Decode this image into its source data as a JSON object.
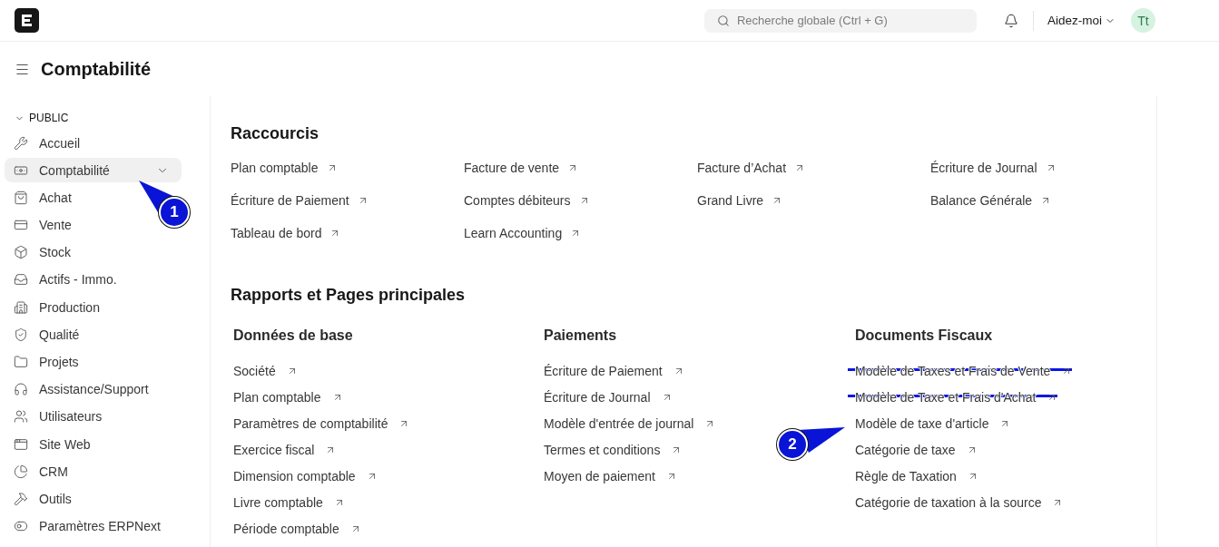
{
  "navbar": {
    "search": {
      "placeholder": "Recherche globale (Ctrl + G)"
    },
    "help": "Aidez-moi",
    "avatar": "Tt"
  },
  "page": {
    "title": "Comptabilité"
  },
  "sidebar": {
    "section": "PUBLIC",
    "expanded": true,
    "items": [
      {
        "label": "Accueil",
        "selected": false,
        "expanded": false
      },
      {
        "label": "Comptabilité",
        "selected": true,
        "expanded": true,
        "callout": "1"
      },
      {
        "label": "Achat",
        "selected": false,
        "expanded": false
      },
      {
        "label": "Vente",
        "selected": false,
        "expanded": false
      },
      {
        "label": "Stock",
        "selected": false,
        "expanded": false
      },
      {
        "label": "Actifs - Immo.",
        "selected": false,
        "expanded": false
      },
      {
        "label": "Production",
        "selected": false,
        "expanded": false
      },
      {
        "label": "Qualité",
        "selected": false,
        "expanded": false
      },
      {
        "label": "Projets",
        "selected": false,
        "expanded": false
      },
      {
        "label": "Assistance/Support",
        "selected": false,
        "expanded": false
      },
      {
        "label": "Utilisateurs",
        "selected": false,
        "expanded": false
      },
      {
        "label": "Site Web",
        "selected": false,
        "expanded": false
      },
      {
        "label": "CRM",
        "selected": false,
        "expanded": false
      },
      {
        "label": "Outils",
        "selected": false,
        "expanded": false
      },
      {
        "label": "Paramètres ERPNext",
        "selected": false,
        "expanded": false
      }
    ]
  },
  "shortcuts": {
    "title": "Raccourcis",
    "items": [
      "Plan comptable",
      "Facture de vente",
      "Facture d’Achat",
      "Écriture de Journal",
      "Écriture de Paiement",
      "Comptes débiteurs",
      "Grand Livre",
      "Balance Générale",
      "Tableau de bord",
      "Learn Accounting"
    ]
  },
  "reports": {
    "title": "Rapports et Pages principales",
    "columns": [
      {
        "title": "Données de base",
        "items": [
          {
            "label": "Société",
            "struck": false
          },
          {
            "label": "Plan comptable",
            "struck": false
          },
          {
            "label": "Paramètres de comptabilité",
            "struck": false
          },
          {
            "label": "Exercice fiscal",
            "struck": false
          },
          {
            "label": "Dimension comptable",
            "struck": false
          },
          {
            "label": "Livre comptable",
            "struck": false
          },
          {
            "label": "Période comptable",
            "struck": false
          }
        ]
      },
      {
        "title": "Paiements",
        "items": [
          {
            "label": "Écriture de Paiement",
            "struck": false
          },
          {
            "label": "Écriture de Journal",
            "struck": false
          },
          {
            "label": "Modèle d'entrée de journal",
            "struck": false
          },
          {
            "label": "Termes et conditions",
            "struck": false
          },
          {
            "label": "Moyen de paiement",
            "struck": false
          }
        ]
      },
      {
        "title": "Documents Fiscaux",
        "items": [
          {
            "label": "Modèle de Taxes et Frais de Vente",
            "struck": true
          },
          {
            "label": "Modèle de Taxe et Frais d'Achat",
            "struck": true
          },
          {
            "label": "Modèle de taxe d'article",
            "struck": false,
            "callout": "2"
          },
          {
            "label": "Catégorie de taxe",
            "struck": false
          },
          {
            "label": "Règle de Taxation",
            "struck": false
          },
          {
            "label": "Catégorie de taxation à la source",
            "struck": false
          }
        ]
      }
    ]
  }
}
